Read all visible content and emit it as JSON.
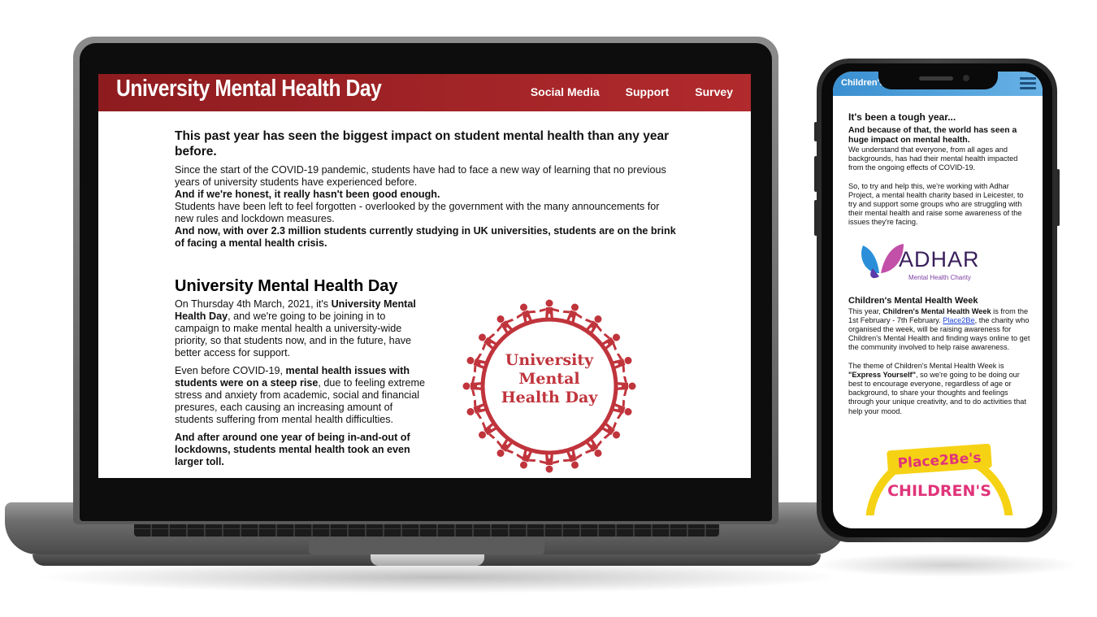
{
  "laptop": {
    "site_title": "University Mental Health Day",
    "nav": [
      "Social Media",
      "Support",
      "Survey"
    ],
    "intro_heading": "This past year has seen the biggest impact on student mental health than any year before.",
    "intro_p1": "Since the start of the COVID-19 pandemic, students have had to face a new way of learning that no previous years of university students have experienced before.",
    "intro_p2_bold": "And if we're honest, it really hasn't been good enough.",
    "intro_p3": "Students have been left to feel forgotten - overlooked by the government with the many announcements for new rules and lockdown measures.",
    "intro_p4_bold": "And now, with over 2.3 million students currently studying in UK universities, students are on the brink of facing a mental health crisis.",
    "umhd_heading": "University Mental Health Day",
    "umhd_p1_a": "On Thursday 4th March, 2021, it's ",
    "umhd_p1_b": "University Mental Health Day",
    "umhd_p1_c": ", and we're going to be joining in to campaign to make mental health a university-wide priority, so that students now, and in the future, have better access for support.",
    "umhd_p2_a": "Even before COVID-19, ",
    "umhd_p2_b": "mental health issues with students were on a steep rise",
    "umhd_p2_c": ", due to feeling extreme stress and anxiety from academic, social and financial presures, each causing an increasing amount of students suffering from mental health difficulties.",
    "umhd_p3_bold": "And after around one year of being in-and-out of lockdowns, students mental health took an even larger toll.",
    "logo_lines": [
      "University",
      "Mental",
      "Health Day"
    ],
    "logo_color": "#c0343c"
  },
  "phone": {
    "header_title": "Children's",
    "header_color": "#3a8fd0",
    "heading1": "It's been a tough year...",
    "sub1": "And because of that, the world has seen a huge impact on mental health.",
    "p1": "We understand that everyone, from all ages and backgrounds, has had their mental health impacted from the ongoing effects of COVID-19.",
    "p2": "So, to try and help this, we're working with Adhar Project, a mental health charity based in Leicester, to try and support some groups who are struggling with their mental health and raise some awareness of the issues they're facing.",
    "adhar_name": "ADHAR",
    "adhar_tagline": "Mental Health Charity",
    "heading2": "Children's Mental Health Week",
    "p3_a": "This year, ",
    "p3_b": "Children's Mental Health Week",
    "p3_c": " is from the 1st February - 7th February. ",
    "p3_link": "Place2Be",
    "p3_d": ", the charity who organised the week, will be raising awareness for Children's Mental Health and finding ways online to get the community involved to help raise awareness.",
    "p4_a": "The theme of Children's Mental Health Week is ",
    "p4_b": "\"Express Yourself\"",
    "p4_c": ", so we're going to be doing our best to encourage everyone, regardless of age or background, to share your thoughts and feelings through your unique creativity, and to do activities that help your mood.",
    "p2b_line1": "Place2Be's",
    "p2b_line2": "CHILDREN'S"
  }
}
